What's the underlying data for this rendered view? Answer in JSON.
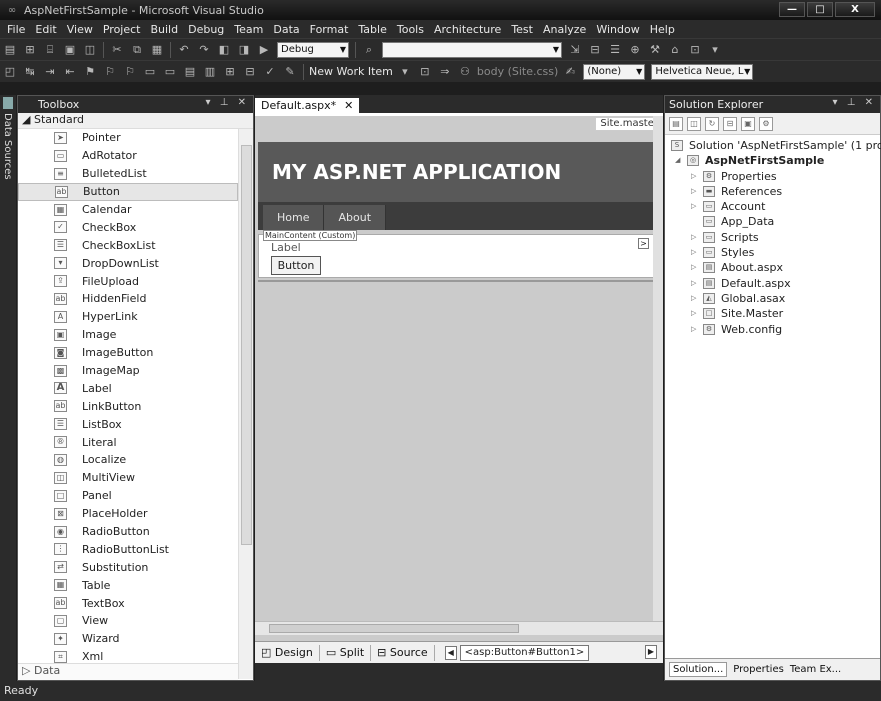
{
  "window": {
    "title": "AspNetFirstSample - Microsoft Visual Studio",
    "minimize": "—",
    "maximize": "□",
    "close": "X"
  },
  "menu": [
    "File",
    "Edit",
    "View",
    "Project",
    "Build",
    "Debug",
    "Team",
    "Data",
    "Format",
    "Table",
    "Tools",
    "Architecture",
    "Test",
    "Analyze",
    "Window",
    "Help"
  ],
  "toolbar1": {
    "config": "Debug",
    "search": ""
  },
  "toolbar2": {
    "new_work_item": "New Work Item",
    "css_target": "body (Site.css)",
    "style": "(None)",
    "font": "Helvetica Neue, L"
  },
  "left_strip": {
    "label": "Data Sources"
  },
  "toolbox": {
    "title": "Toolbox",
    "section": "Standard",
    "items": [
      {
        "label": "Pointer",
        "icon": "pointer-icon"
      },
      {
        "label": "AdRotator",
        "icon": "adrotator-icon"
      },
      {
        "label": "BulletedList",
        "icon": "bulletedlist-icon"
      },
      {
        "label": "Button",
        "icon": "button-icon"
      },
      {
        "label": "Calendar",
        "icon": "calendar-icon"
      },
      {
        "label": "CheckBox",
        "icon": "checkbox-icon"
      },
      {
        "label": "CheckBoxList",
        "icon": "checkboxlist-icon"
      },
      {
        "label": "DropDownList",
        "icon": "dropdownlist-icon"
      },
      {
        "label": "FileUpload",
        "icon": "fileupload-icon"
      },
      {
        "label": "HiddenField",
        "icon": "hiddenfield-icon"
      },
      {
        "label": "HyperLink",
        "icon": "hyperlink-icon"
      },
      {
        "label": "Image",
        "icon": "image-icon"
      },
      {
        "label": "ImageButton",
        "icon": "imagebutton-icon"
      },
      {
        "label": "ImageMap",
        "icon": "imagemap-icon"
      },
      {
        "label": "Label",
        "icon": "label-icon"
      },
      {
        "label": "LinkButton",
        "icon": "linkbutton-icon"
      },
      {
        "label": "ListBox",
        "icon": "listbox-icon"
      },
      {
        "label": "Literal",
        "icon": "literal-icon"
      },
      {
        "label": "Localize",
        "icon": "localize-icon"
      },
      {
        "label": "MultiView",
        "icon": "multiview-icon"
      },
      {
        "label": "Panel",
        "icon": "panel-icon"
      },
      {
        "label": "PlaceHolder",
        "icon": "placeholder-icon"
      },
      {
        "label": "RadioButton",
        "icon": "radiobutton-icon"
      },
      {
        "label": "RadioButtonList",
        "icon": "radiobuttonlist-icon"
      },
      {
        "label": "Substitution",
        "icon": "substitution-icon"
      },
      {
        "label": "Table",
        "icon": "table-icon"
      },
      {
        "label": "TextBox",
        "icon": "textbox-icon"
      },
      {
        "label": "View",
        "icon": "view-icon"
      },
      {
        "label": "Wizard",
        "icon": "wizard-icon"
      },
      {
        "label": "Xml",
        "icon": "xml-icon"
      }
    ],
    "selected": "Button",
    "next_section": "Data"
  },
  "editor": {
    "tab": "Default.aspx*",
    "master": "Site.master",
    "app_title": "MY ASP.NET APPLICATION",
    "nav": [
      "Home",
      "About"
    ],
    "content_tag": "MainContent (Custom)",
    "label_text": "Label",
    "button_text": "Button",
    "views": [
      "Design",
      "Split",
      "Source"
    ],
    "breadcrumb": "<asp:Button#Button1>"
  },
  "solution_explorer": {
    "title": "Solution Explorer",
    "solution": "Solution 'AspNetFirstSample' (1 project)",
    "project": "AspNetFirstSample",
    "items": [
      "Properties",
      "References",
      "Account",
      "App_Data",
      "Scripts",
      "Styles",
      "About.aspx",
      "Default.aspx",
      "Global.asax",
      "Site.Master",
      "Web.config"
    ],
    "tabs": [
      "Solution...",
      "Properties",
      "Team Ex..."
    ]
  },
  "status": "Ready"
}
